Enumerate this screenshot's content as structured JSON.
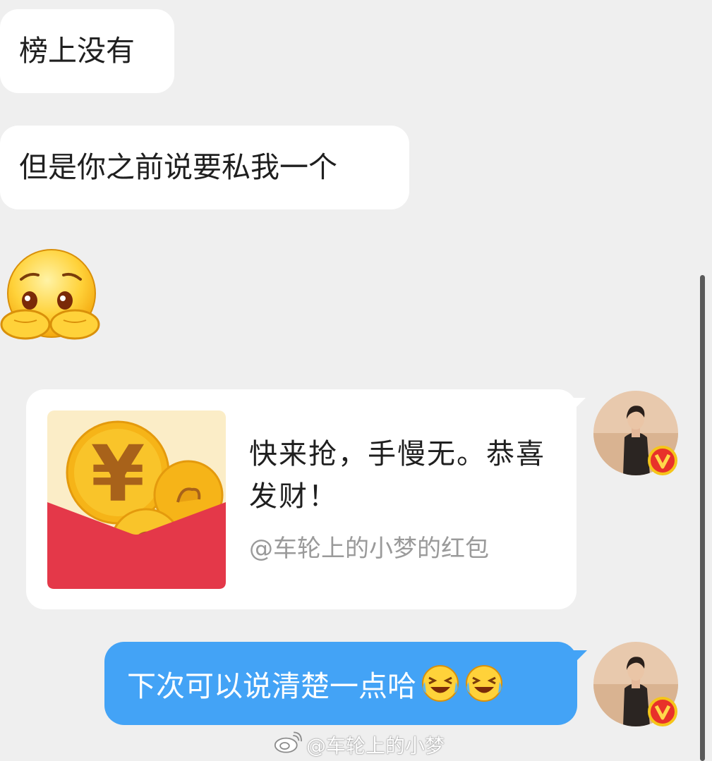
{
  "messages": {
    "incoming_1": "榜上没有",
    "incoming_2": "但是你之前说要私我一个",
    "red_packet": {
      "title": "快来抢，手慢无。恭喜发财！",
      "subtitle": "@车轮上的小梦的红包"
    },
    "outgoing_1": "下次可以说清楚一点哈"
  },
  "watermark": "@车轮上的小梦",
  "icons": {
    "incoming_emoji": "pleading-face-icon",
    "laugh_emoji": "laughing-crying-face-icon",
    "envelope": "red-packet-icon",
    "verified": "verified-v-badge-icon",
    "weibo": "weibo-logo-icon"
  },
  "colors": {
    "background": "#efefef",
    "incoming_bubble": "#ffffff",
    "outgoing_bubble": "#43a3f6",
    "red_packet": "#e43849",
    "coin": "#f6b418",
    "badge": "#e8312a"
  }
}
